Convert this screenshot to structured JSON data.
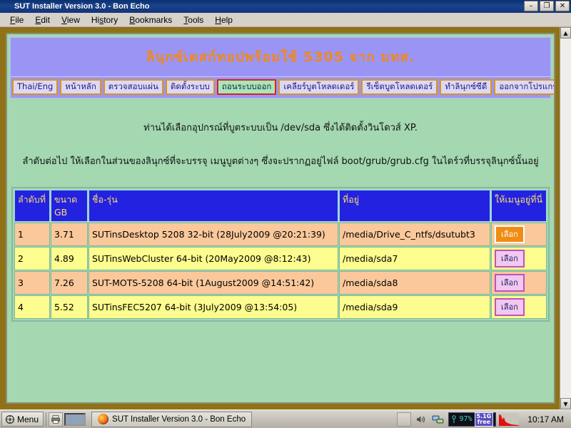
{
  "window": {
    "title": "SUT Installer Version 3.0 - Bon Echo",
    "buttons": {
      "minimize": "–",
      "maximize": "❐",
      "close": "✕"
    },
    "icon": "firefox-icon"
  },
  "menubar": {
    "items": [
      {
        "label": "File"
      },
      {
        "label": "Edit"
      },
      {
        "label": "View"
      },
      {
        "label": "History"
      },
      {
        "label": "Bookmarks"
      },
      {
        "label": "Tools"
      },
      {
        "label": "Help"
      }
    ]
  },
  "page": {
    "banner_title": "ลินุกซ์เดสก์ทอปพร้อมใช้ 5305 จาก มทส.",
    "nav_buttons": [
      {
        "label": "Thai/Eng",
        "active": false
      },
      {
        "label": "หน้าหลัก",
        "active": false
      },
      {
        "label": "ตรวจสอบแผ่น",
        "active": false
      },
      {
        "label": "ติดตั้งระบบ",
        "active": false
      },
      {
        "label": "ถอนระบบออก",
        "active": true
      },
      {
        "label": "เคลียร์บูตโหลดเดอร์",
        "active": false
      },
      {
        "label": "รีเซ็ตบูตโหลดเดอร์",
        "active": false
      },
      {
        "label": "ทำลินุกซ์ซีดี",
        "active": false
      },
      {
        "label": "ออกจากโปรแกรม",
        "active": false
      }
    ],
    "paragraphs": [
      "ท่านได้เลือกอุปกรณ์ที่บูตระบบเป็น /dev/sda ซึ่งได้ติดตั้งวินโดวส์ XP.",
      "ลำดับต่อไป ให้เลือกในส่วนของลินุกซ์ที่จะบรรจุ เมนูบูตต่างๆ ซึ่งจะปรากฏอยู่ไฟล์ boot/grub/grub.cfg ในไดร์วที่บรรจุลินุกซ์นั้นอยู่"
    ],
    "table": {
      "headers": [
        {
          "label": "ลำดับที่"
        },
        {
          "label": "ขนาด GB"
        },
        {
          "label": "ชื่อ-รุ่น"
        },
        {
          "label": "ที่อยู่"
        },
        {
          "label": "ให้เมนูอยู่ที่นี่"
        }
      ],
      "rows": [
        {
          "no": "1",
          "size": "3.71",
          "name": "SUTinsDesktop  5208  32-bit  (28July2009  @20:21:39)",
          "path": "/media/Drive_C_ntfs/dsutubt3",
          "action": "เลือก",
          "highlight": true
        },
        {
          "no": "2",
          "size": "4.89",
          "name": "SUTinsWebCluster  64-bit  (20May2009  @8:12:43)",
          "path": "/media/sda7",
          "action": "เลือก",
          "highlight": false
        },
        {
          "no": "3",
          "size": "7.26",
          "name": "SUT-MOTS-5208  64-bit  (1August2009  @14:51:42)",
          "path": "/media/sda8",
          "action": "เลือก",
          "highlight": false
        },
        {
          "no": "4",
          "size": "5.52",
          "name": "SUTinsFEC5207  64-bit  (3July2009  @13:54:05)",
          "path": "/media/sda9",
          "action": "เลือก",
          "highlight": false
        }
      ]
    }
  },
  "scrollbar": {
    "up": "▲",
    "down": "▼"
  },
  "taskbar": {
    "start_label": "Menu",
    "start_icon": "menu-icon",
    "launcher_icon": "printer-icon",
    "task_label": "SUT Installer Version 3.0 - Bon Echo",
    "tray": {
      "volume_icon": "speaker-icon",
      "network_icon": "network-icon",
      "cpu_label": "97%",
      "mem_line1": "5.1G",
      "mem_line2": "free",
      "clock": "10:17 AM"
    }
  },
  "colors": {
    "banner_bg": "#9a95f5",
    "banner_text": "#f08820",
    "page_bg": "#a3d8b0",
    "frame": "#8f7218",
    "table_header_bg": "#2222e0",
    "table_header_text": "#ffdb6e",
    "row_odd": "#fac89a",
    "row_even": "#fdfc8e",
    "active_nav_bg": "#a8e8b2",
    "active_nav_border": "#e02020",
    "highlight_button": "#f08c14"
  }
}
